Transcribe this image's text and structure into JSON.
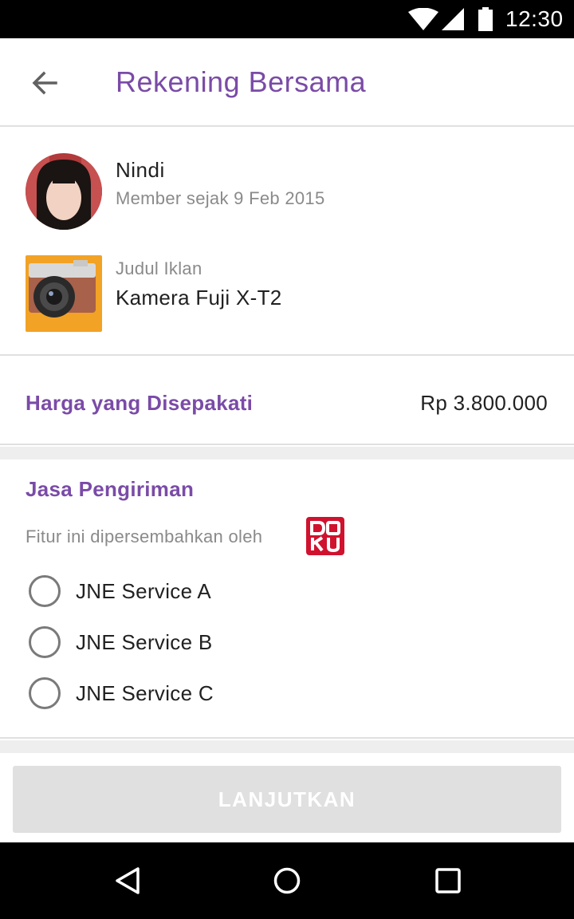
{
  "status_bar": {
    "time": "12:30",
    "icons": [
      "wifi-icon",
      "signal-icon",
      "battery-icon"
    ]
  },
  "app_bar": {
    "back_icon": "arrow-back-icon",
    "title": "Rekening Bersama"
  },
  "seller": {
    "name": "Nindi",
    "member_since": "Member sejak 9 Feb 2015",
    "ad_label": "Judul Iklan",
    "ad_title": "Kamera Fuji X-T2"
  },
  "price": {
    "label": "Harga yang Disepakati",
    "value": "Rp 3.800.000"
  },
  "shipping": {
    "heading": "Jasa Pengiriman",
    "provided_by": "Fitur ini dipersembahkan oleh",
    "provider_logo": "DOKU",
    "options": [
      {
        "label": "JNE Service A",
        "selected": false
      },
      {
        "label": "JNE Service B",
        "selected": false
      },
      {
        "label": "JNE Service C",
        "selected": false
      }
    ]
  },
  "footer": {
    "cta_label": "LANJUTKAN",
    "cta_enabled": false
  },
  "colors": {
    "accent": "#7a4ba7",
    "doku_red": "#d0122e",
    "disabled_button": "#e0e0e0"
  },
  "nav_bar": {
    "icons": [
      "nav-back-icon",
      "nav-home-icon",
      "nav-recents-icon"
    ]
  }
}
